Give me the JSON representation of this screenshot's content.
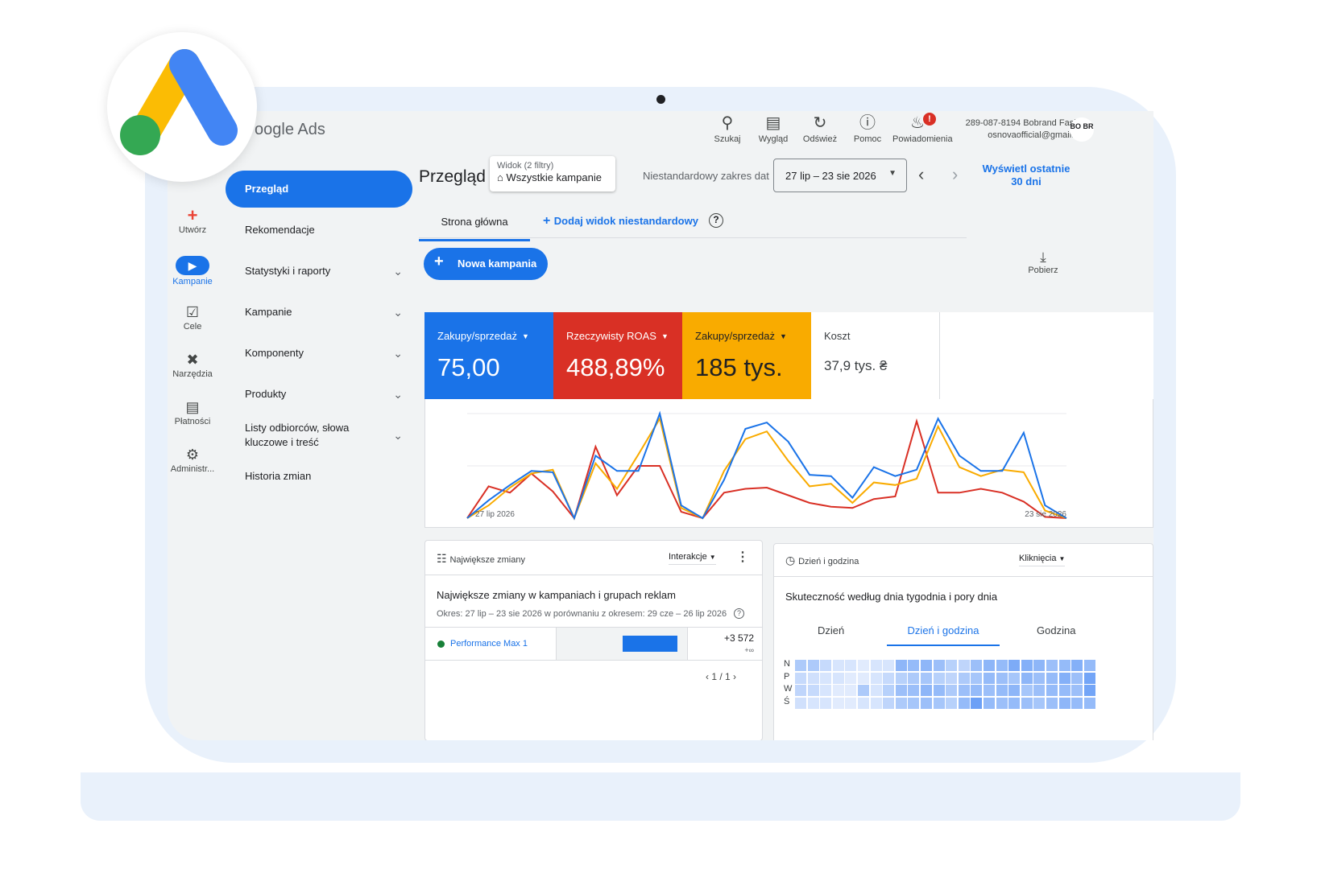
{
  "brand": {
    "name": "oogle Ads"
  },
  "rail": [
    {
      "label": "Utwórz",
      "icon": "plus-icon"
    },
    {
      "label": "Kampanie",
      "icon": "megaphone-icon"
    },
    {
      "label": "Cele",
      "icon": "trophy-icon"
    },
    {
      "label": "Narzędzia",
      "icon": "tools-icon"
    },
    {
      "label": "Płatności",
      "icon": "card-icon"
    },
    {
      "label": "Administr...",
      "icon": "gear-icon"
    }
  ],
  "nav": [
    {
      "label": "Przegląd"
    },
    {
      "label": "Rekomendacje"
    },
    {
      "label": "Statystyki i raporty"
    },
    {
      "label": "Kampanie"
    },
    {
      "label": "Komponenty"
    },
    {
      "label": "Produkty"
    },
    {
      "label": "Listy odbiorców, słowa kluczowe i treść"
    },
    {
      "label": "Historia zmian"
    }
  ],
  "toolbar": {
    "search": "Szukaj",
    "view": "Wygląd",
    "refresh": "Odśwież",
    "help": "Pomoc",
    "notif": "Powiadomienia",
    "notif_badge": "!"
  },
  "account": {
    "line1": "289-087-8194 Bobrand Fashion",
    "line2": "osnovaofficial@gmail.com",
    "avatar": "BO BR"
  },
  "page": {
    "title": "Przegląd",
    "view_label": "Widok (2 filtry)",
    "view_value": "Wszystkie kampanie",
    "date_label": "Niestandardowy zakres dat",
    "date_value": "27 lip – 23 sie 2026",
    "last30": "Wyświetl ostatnie 30 dni"
  },
  "tabs": {
    "home": "Strona główna",
    "add": "Dodaj widok niestandardowy"
  },
  "new_campaign": "Nowa kampania",
  "download": "Pobierz",
  "metrics": [
    {
      "label": "Zakupy/sprzedaż",
      "value": "75,00",
      "color": "#1a73e8"
    },
    {
      "label": "Rzeczywisty ROAS",
      "value": "488,89%",
      "color": "#d93025"
    },
    {
      "label": "Zakupy/sprzedaż",
      "value": "185 tys.",
      "color": "#f9ab00"
    },
    {
      "label": "Koszt",
      "value": "37,9 tys. ₴",
      "color": "#ffffff"
    }
  ],
  "chart_data": {
    "type": "line",
    "x_start": "27 lip 2026",
    "x_end": "23 sie 2026",
    "series": [
      {
        "color": "#1a73e8",
        "values": [
          0,
          14,
          26,
          37,
          36,
          0,
          49,
          37,
          37,
          82,
          10,
          0,
          30,
          70,
          75,
          60,
          34,
          33,
          16,
          40,
          33,
          38,
          78,
          49,
          37,
          37,
          67,
          10,
          0
        ]
      },
      {
        "color": "#f9ab00",
        "values": [
          0,
          10,
          24,
          35,
          38,
          0,
          43,
          23,
          50,
          78,
          8,
          0,
          37,
          62,
          68,
          45,
          25,
          27,
          12,
          28,
          26,
          31,
          72,
          40,
          33,
          38,
          36,
          6,
          0
        ]
      },
      {
        "color": "#d93025",
        "values": [
          0,
          25,
          20,
          35,
          21,
          0,
          56,
          18,
          41,
          41,
          5,
          0,
          20,
          23,
          24,
          18,
          12,
          9,
          8,
          15,
          17,
          76,
          20,
          20,
          23,
          20,
          13,
          1,
          0
        ]
      }
    ]
  },
  "changes": {
    "header": "Największe zmiany",
    "filter": "Interakcje",
    "title": "Największe zmiany w kampaniach i grupach reklam",
    "period": "Okres: 27 lip – 23 sie 2026 w porównaniu z okresem: 29 cze – 26 lip 2026",
    "row_name": "Performance Max 1",
    "row_value": "+3 572",
    "row_sub": "+∞",
    "pager": "1 / 1"
  },
  "dayhour": {
    "header": "Dzień i godzina",
    "filter": "Kliknięcia",
    "title": "Skuteczność według dnia tygodnia i pory dnia",
    "tabs": [
      "Dzień",
      "Dzień i godzina",
      "Godzina"
    ],
    "rows": [
      "N",
      "P",
      "W",
      "Ś"
    ],
    "levels": [
      [
        0.35,
        0.35,
        0.2,
        0.1,
        0.1,
        0.05,
        0.1,
        0.1,
        0.55,
        0.5,
        0.55,
        0.45,
        0.3,
        0.25,
        0.45,
        0.55,
        0.5,
        0.65,
        0.6,
        0.55,
        0.45,
        0.5,
        0.6,
        0.5
      ],
      [
        0.2,
        0.15,
        0.1,
        0.1,
        0.05,
        0.05,
        0.1,
        0.2,
        0.3,
        0.35,
        0.4,
        0.3,
        0.25,
        0.35,
        0.4,
        0.5,
        0.45,
        0.4,
        0.55,
        0.45,
        0.5,
        0.6,
        0.45,
        0.7
      ],
      [
        0.25,
        0.2,
        0.1,
        0.05,
        0.05,
        0.35,
        0.1,
        0.3,
        0.45,
        0.45,
        0.55,
        0.5,
        0.35,
        0.45,
        0.5,
        0.45,
        0.5,
        0.55,
        0.4,
        0.45,
        0.5,
        0.5,
        0.45,
        0.7
      ],
      [
        0.15,
        0.1,
        0.1,
        0.05,
        0.05,
        0.1,
        0.1,
        0.25,
        0.35,
        0.4,
        0.45,
        0.4,
        0.3,
        0.5,
        0.75,
        0.5,
        0.45,
        0.5,
        0.45,
        0.4,
        0.45,
        0.55,
        0.5,
        0.5
      ]
    ]
  }
}
